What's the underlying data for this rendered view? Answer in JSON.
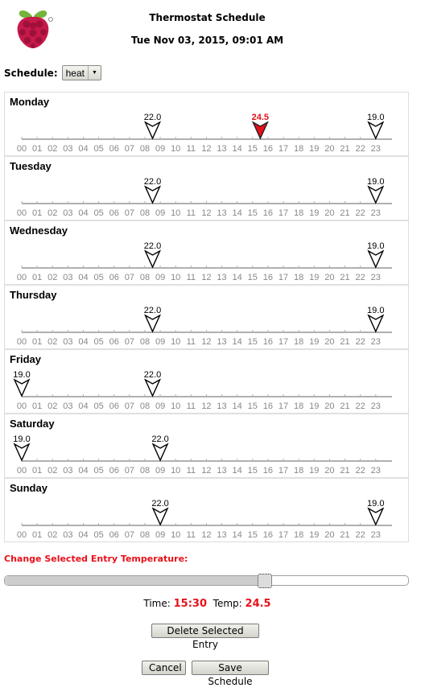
{
  "header": {
    "title": "Thermostat Schedule",
    "datetime": "Tue Nov 03, 2015, 09:01 AM",
    "logo": "raspberry-pi-logo"
  },
  "schedule": {
    "label": "Schedule:",
    "selected": "heat"
  },
  "hours": [
    "00",
    "01",
    "02",
    "03",
    "04",
    "05",
    "06",
    "07",
    "08",
    "09",
    "10",
    "11",
    "12",
    "13",
    "14",
    "15",
    "16",
    "17",
    "18",
    "19",
    "20",
    "21",
    "22",
    "23"
  ],
  "days": [
    {
      "name": "Monday",
      "entries": [
        {
          "time": "08:30",
          "temp": "22.0",
          "selected": false
        },
        {
          "time": "15:30",
          "temp": "24.5",
          "selected": true
        },
        {
          "time": "23:00",
          "temp": "19.0",
          "selected": false
        }
      ]
    },
    {
      "name": "Tuesday",
      "entries": [
        {
          "time": "08:30",
          "temp": "22.0",
          "selected": false
        },
        {
          "time": "23:00",
          "temp": "19.0",
          "selected": false
        }
      ]
    },
    {
      "name": "Wednesday",
      "entries": [
        {
          "time": "08:30",
          "temp": "22.0",
          "selected": false
        },
        {
          "time": "23:00",
          "temp": "19.0",
          "selected": false
        }
      ]
    },
    {
      "name": "Thursday",
      "entries": [
        {
          "time": "08:30",
          "temp": "22.0",
          "selected": false
        },
        {
          "time": "23:00",
          "temp": "19.0",
          "selected": false
        }
      ]
    },
    {
      "name": "Friday",
      "entries": [
        {
          "time": "00:00",
          "temp": "19.0",
          "selected": false
        },
        {
          "time": "08:30",
          "temp": "22.0",
          "selected": false
        }
      ]
    },
    {
      "name": "Saturday",
      "entries": [
        {
          "time": "00:00",
          "temp": "19.0",
          "selected": false
        },
        {
          "time": "09:00",
          "temp": "22.0",
          "selected": false
        }
      ]
    },
    {
      "name": "Sunday",
      "entries": [
        {
          "time": "09:00",
          "temp": "22.0",
          "selected": false
        },
        {
          "time": "23:00",
          "temp": "19.0",
          "selected": false
        }
      ]
    }
  ],
  "colors": {
    "selected": "#e8101a",
    "marker": "#000000",
    "axis": "#b0b0b0",
    "tick_label": "#888888"
  },
  "editor": {
    "label": "Change Selected Entry Temperature:",
    "slider_fraction": 0.63,
    "time_label": "Time:",
    "time_value": "15:30",
    "temp_label": "Temp:",
    "temp_value": "24.5"
  },
  "buttons": {
    "delete": "Delete Selected Entry",
    "cancel": "Cancel",
    "save": "Save Schedule"
  }
}
